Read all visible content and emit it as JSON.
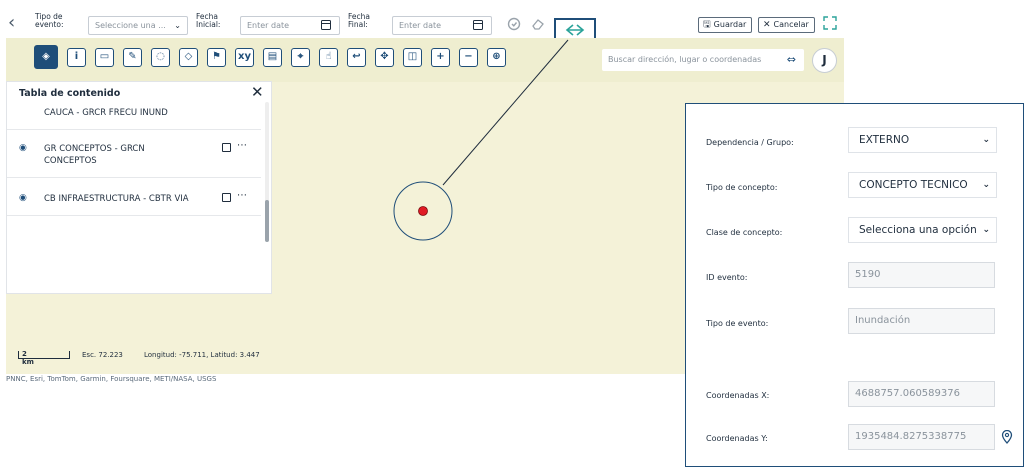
{
  "toolbar": {
    "tipo_evento_label_1": "Tipo de",
    "tipo_evento_label_2": "evento:",
    "tipo_evento_placeholder": "Seleccione una ...",
    "fecha_inicial_label_1": "Fecha",
    "fecha_inicial_label_2": "Inicial:",
    "fecha_inicial_placeholder": "Enter date",
    "fecha_final_label_1": "Fecha",
    "fecha_final_label_2": "Final:",
    "fecha_final_placeholder": "Enter date",
    "save_label": "Guardar",
    "cancel_label": "Cancelar"
  },
  "map": {
    "search_placeholder": "Buscar dirección, lugar o coordenadas",
    "avatar_initial": "J",
    "tools": [
      "layers",
      "info",
      "measure",
      "draw",
      "comment",
      "erase",
      "flag",
      "xy",
      "print",
      "map-pin",
      "hand",
      "back-arrow",
      "move",
      "compare",
      "zoom-in",
      "zoom-out",
      "coords"
    ],
    "scale": "2 km",
    "scale_text": "Esc. 72.223",
    "coord_text": "Longitud: -75.711, Latitud: 3.447",
    "attribution": "PNNC, Esri, TomTom, Garmin, Foursquare, METI/NASA, USGS"
  },
  "toc": {
    "title": "Tabla de contenido",
    "items": [
      {
        "name": "CAUCA - GRCR FRECU INUND"
      },
      {
        "name_line1": "GR CONCEPTOS - GRCN",
        "name_line2": "CONCEPTOS"
      },
      {
        "name": "CB INFRAESTRUCTURA - CBTR VIA"
      }
    ]
  },
  "form": {
    "dependencia_label": "Dependencia / Grupo:",
    "dependencia_value": "EXTERNO",
    "tipo_concepto_label": "Tipo de concepto:",
    "tipo_concepto_value": "CONCEPTO TECNICO",
    "clase_concepto_label": "Clase de concepto:",
    "clase_concepto_value": "Selecciona una opción",
    "id_evento_label": "ID evento:",
    "id_evento_value": "5190",
    "tipo_evento_label": "Tipo de evento:",
    "tipo_evento_value": "Inundación",
    "coord_x_label": "Coordenadas X:",
    "coord_x_value": "4688757.060589376",
    "coord_y_label": "Coordenadas Y:",
    "coord_y_value": "1935484.8275338775"
  },
  "colors": {
    "accent": "#1f4e79",
    "teal": "#2ba39a",
    "map_bg": "#f4f2d8",
    "marker": "#e01b24"
  }
}
